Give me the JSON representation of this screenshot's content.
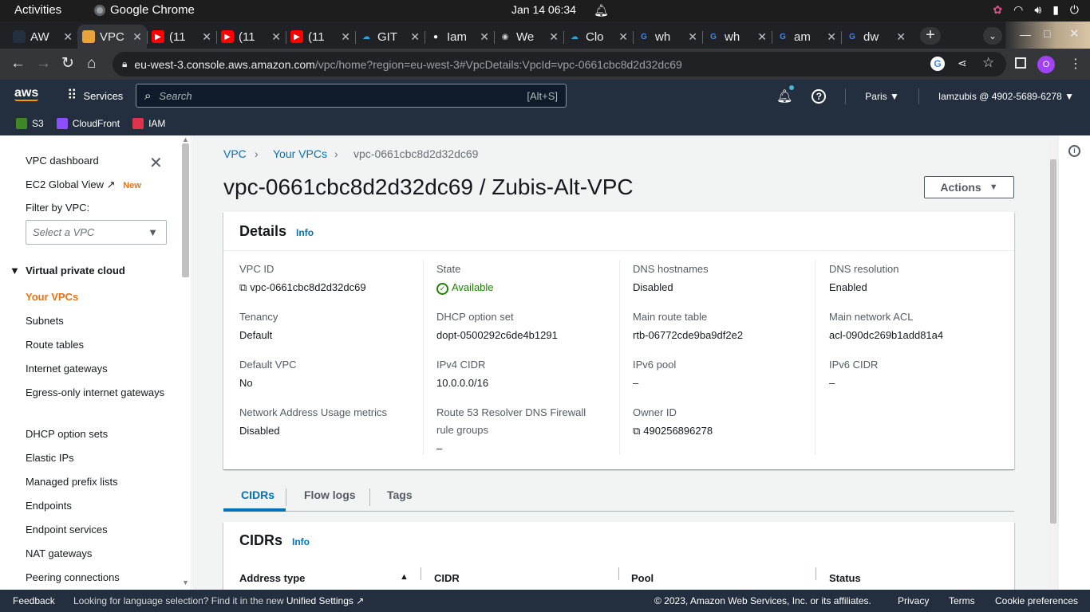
{
  "os": {
    "activities": "Activities",
    "app_name": "Google Chrome",
    "clock": "Jan 14  06:34"
  },
  "browser": {
    "tabs": [
      {
        "title": "AW",
        "icon": "aws-favicon"
      },
      {
        "title": "VPC",
        "icon": "vpc-cube-favicon"
      },
      {
        "title": "(11",
        "icon": "youtube-favicon"
      },
      {
        "title": "(11",
        "icon": "youtube-favicon"
      },
      {
        "title": "(11",
        "icon": "youtube-favicon"
      },
      {
        "title": "GIT",
        "icon": "cloud-favicon"
      },
      {
        "title": "Iam",
        "icon": "github-favicon"
      },
      {
        "title": "We",
        "icon": "web-favicon"
      },
      {
        "title": "Clo",
        "icon": "cloud-favicon"
      },
      {
        "title": "wh",
        "icon": "google-favicon"
      },
      {
        "title": "wh",
        "icon": "google-favicon"
      },
      {
        "title": "am",
        "icon": "google-favicon"
      },
      {
        "title": "dw",
        "icon": "google-favicon"
      }
    ],
    "url_host": "eu-west-3.console.aws.amazon.com",
    "url_path": "/vpc/home?region=eu-west-3#VpcDetails:VpcId=vpc-0661cbc8d2d32dc69",
    "profile_initial": "O"
  },
  "aws_nav": {
    "logo": "aws",
    "services": "Services",
    "search_placeholder": "Search",
    "search_shortcut": "[Alt+S]",
    "region": "Paris",
    "account": "Iamzubis @ 4902-5689-6278"
  },
  "favorites": [
    {
      "label": "S3",
      "color": "#3f8624"
    },
    {
      "label": "CloudFront",
      "color": "#8c4fff"
    },
    {
      "label": "IAM",
      "color": "#dd344c"
    }
  ],
  "sidenav": {
    "dashboard": "VPC dashboard",
    "global_view": "EC2 Global View",
    "new_badge": "New",
    "filter_label": "Filter by VPC:",
    "filter_placeholder": "Select a VPC",
    "section": "Virtual private cloud",
    "items": [
      "Your VPCs",
      "Subnets",
      "Route tables",
      "Internet gateways",
      "Egress-only internet gateways",
      "DHCP option sets",
      "Elastic IPs",
      "Managed prefix lists",
      "Endpoints",
      "Endpoint services",
      "NAT gateways",
      "Peering connections"
    ]
  },
  "breadcrumb": [
    "VPC",
    "Your VPCs",
    "vpc-0661cbc8d2d32dc69"
  ],
  "page_title": "vpc-0661cbc8d2d32dc69 / Zubis-Alt-VPC",
  "actions_label": "Actions",
  "details": {
    "title": "Details",
    "info": "Info",
    "fields": {
      "vpc_id": {
        "label": "VPC ID",
        "value": "vpc-0661cbc8d2d32dc69"
      },
      "state": {
        "label": "State",
        "value": "Available"
      },
      "dns_hostnames": {
        "label": "DNS hostnames",
        "value": "Disabled"
      },
      "dns_resolution": {
        "label": "DNS resolution",
        "value": "Enabled"
      },
      "tenancy": {
        "label": "Tenancy",
        "value": "Default"
      },
      "dhcp": {
        "label": "DHCP option set",
        "value": "dopt-0500292c6de4b1291"
      },
      "main_route": {
        "label": "Main route table",
        "value": "rtb-06772cde9ba9df2e2"
      },
      "main_acl": {
        "label": "Main network ACL",
        "value": "acl-090dc269b1add81a4"
      },
      "default_vpc": {
        "label": "Default VPC",
        "value": "No"
      },
      "ipv4": {
        "label": "IPv4 CIDR",
        "value": "10.0.0.0/16"
      },
      "ipv6_pool": {
        "label": "IPv6 pool",
        "value": "–"
      },
      "ipv6_cidr": {
        "label": "IPv6 CIDR",
        "value": "–"
      },
      "nau": {
        "label": "Network Address Usage metrics",
        "value": "Disabled"
      },
      "r53": {
        "label": "Route 53 Resolver DNS Firewall rule groups",
        "value": "–"
      },
      "owner": {
        "label": "Owner ID",
        "value": "490256896278"
      }
    }
  },
  "tabs": [
    "CIDRs",
    "Flow logs",
    "Tags"
  ],
  "cidrs": {
    "title": "CIDRs",
    "info": "Info",
    "columns": [
      "Address type",
      "CIDR",
      "Pool",
      "Status"
    ]
  },
  "footer": {
    "feedback": "Feedback",
    "lang_prefix": "Looking for language selection? Find it in the new",
    "lang_link": "Unified Settings",
    "copyright": "© 2023, Amazon Web Services, Inc. or its affiliates.",
    "privacy": "Privacy",
    "terms": "Terms",
    "cookies": "Cookie preferences"
  }
}
